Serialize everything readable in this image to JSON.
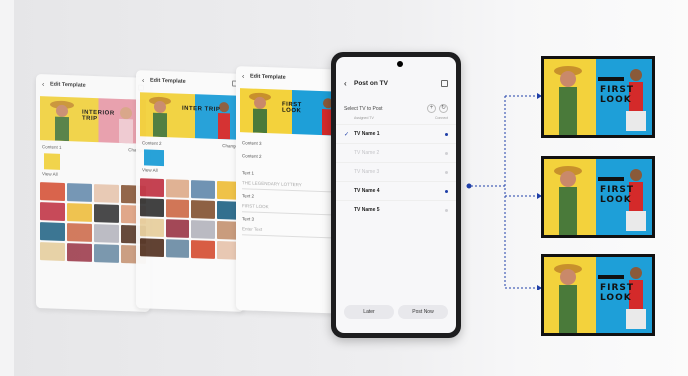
{
  "colors": {
    "banner_yellow": "#f3d23c",
    "banner_pink": "#e89aa8",
    "banner_blue": "#1e9fd8",
    "banner_red": "#d42a2a",
    "accent_blue": "#1f3fa8"
  },
  "screens": [
    {
      "title": "Edit Template",
      "banner_text": "INTERIOR TRIP",
      "content_label": "Content 1",
      "content_action": "Change",
      "view_all": "View All"
    },
    {
      "title": "Edit Template",
      "banner_text": "INTER TRIP",
      "content_label": "Content 2",
      "content_action": "Change",
      "view_all": "View All"
    },
    {
      "title": "Edit Template",
      "banner_text": "FIRST LOOK",
      "rows": [
        "Content 3",
        "Content 2"
      ],
      "fields": [
        {
          "label": "Text 1",
          "value": "THE LEGENDARY LOTTERY"
        },
        {
          "label": "Text 2",
          "value": "FIRST LOOK"
        },
        {
          "label": "Text 3",
          "value": "Enter Text"
        }
      ]
    }
  ],
  "phone": {
    "title": "Post on TV",
    "select_label": "Select TV to Post",
    "col_left": "Assigned TV",
    "col_right": "Connect",
    "tv_list": [
      {
        "name": "TV Name 1",
        "selected": true,
        "dim": false
      },
      {
        "name": "TV Name 2",
        "selected": false,
        "dim": true
      },
      {
        "name": "TV Name 3",
        "selected": false,
        "dim": true
      },
      {
        "name": "TV Name 4",
        "selected": false,
        "dim": false
      },
      {
        "name": "TV Name 5",
        "selected": false,
        "dim": false
      }
    ],
    "later_button": "Later",
    "post_now_button": "Post Now"
  },
  "tv_headline": "FIRST LOOK"
}
